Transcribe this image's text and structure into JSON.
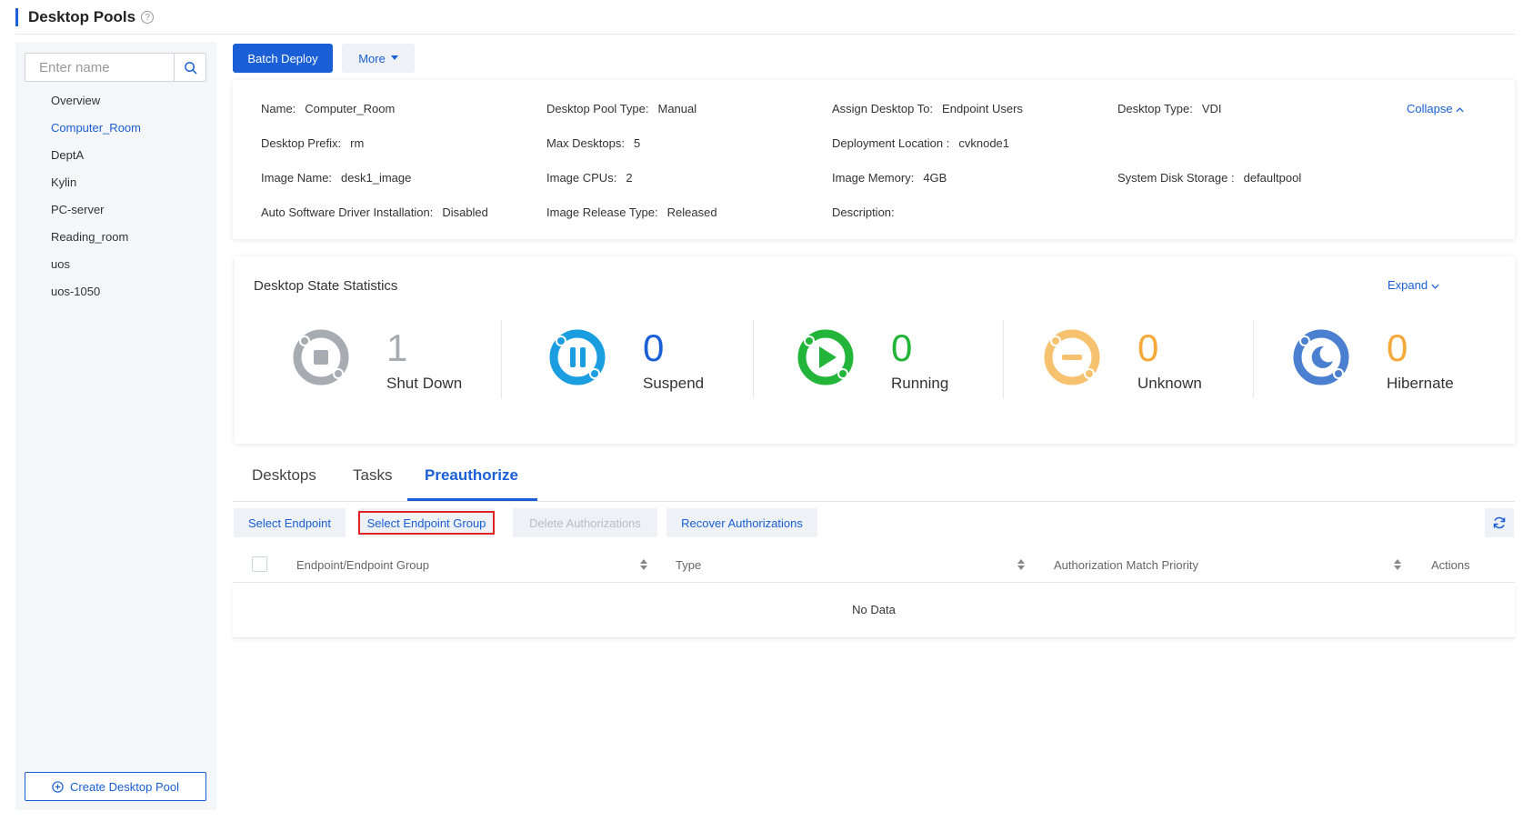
{
  "header": {
    "title": "Desktop Pools",
    "help_icon": "question-circle-icon"
  },
  "sidebar": {
    "search_placeholder": "Enter name",
    "items": [
      {
        "label": "Overview",
        "active": false
      },
      {
        "label": "Computer_Room",
        "active": true
      },
      {
        "label": "DeptA",
        "active": false
      },
      {
        "label": "Kylin",
        "active": false
      },
      {
        "label": "PC-server",
        "active": false
      },
      {
        "label": "Reading_room",
        "active": false
      },
      {
        "label": "uos",
        "active": false
      },
      {
        "label": "uos-1050",
        "active": false
      }
    ],
    "create_label": "Create Desktop Pool"
  },
  "toolbar": {
    "batch_deploy": "Batch Deploy",
    "more": "More"
  },
  "info": {
    "name_label": "Name:",
    "name_value": "Computer_Room",
    "pool_type_label": "Desktop Pool Type:",
    "pool_type_value": "Manual",
    "assign_label": "Assign Desktop To:",
    "assign_value": "Endpoint Users",
    "desktop_type_label": "Desktop Type:",
    "desktop_type_value": "VDI",
    "collapse": "Collapse",
    "prefix_label": "Desktop Prefix:",
    "prefix_value": "rm",
    "max_label": "Max Desktops:",
    "max_value": "5",
    "location_label": "Deployment Location :",
    "location_value": "cvknode1",
    "image_label": "Image Name:",
    "image_value": "desk1_image",
    "cpus_label": "Image CPUs:",
    "cpus_value": "2",
    "memory_label": "Image Memory:",
    "memory_value": "4GB",
    "storage_label": "System Disk Storage :",
    "storage_value": "defaultpool",
    "driver_label": "Auto Software Driver Installation:",
    "driver_value": "Disabled",
    "release_label": "Image Release Type:",
    "release_value": "Released",
    "desc_label": "Description:"
  },
  "stats": {
    "title": "Desktop State Statistics",
    "expand": "Expand",
    "items": [
      {
        "label": "Shut Down",
        "count": "1",
        "color": "#a7acb3",
        "icon": "shutdown-icon"
      },
      {
        "label": "Suspend",
        "count": "0",
        "color": "#1a9ee0",
        "icon": "pause-icon"
      },
      {
        "label": "Running",
        "count": "0",
        "color": "#22b53a",
        "icon": "play-icon"
      },
      {
        "label": "Unknown",
        "count": "0",
        "color": "#f6c270",
        "icon": "unknown-icon"
      },
      {
        "label": "Hibernate",
        "count": "0",
        "color": "#4b7fd0",
        "icon": "moon-icon"
      }
    ]
  },
  "tabs": [
    {
      "label": "Desktops",
      "active": false
    },
    {
      "label": "Tasks",
      "active": false
    },
    {
      "label": "Preauthorize",
      "active": true
    }
  ],
  "actions": {
    "select_endpoint": "Select Endpoint",
    "select_group": "Select Endpoint Group",
    "delete_auth": "Delete Authorizations",
    "recover_auth": "Recover Authorizations"
  },
  "table": {
    "columns": [
      "Endpoint/Endpoint Group",
      "Type",
      "Authorization Match Priority",
      "Actions"
    ],
    "empty": "No Data"
  }
}
